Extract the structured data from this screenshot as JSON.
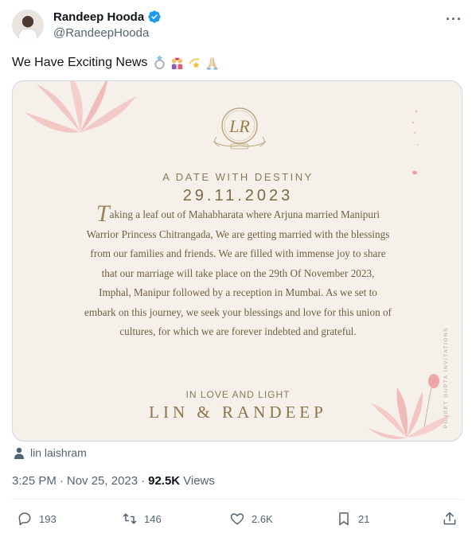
{
  "author": {
    "name": "Randeep Hooda",
    "handle": "@RandeepHooda",
    "verified": true,
    "avatar_icon": "profile-photo"
  },
  "tweet": {
    "text": "We Have Exciting News",
    "emojis": [
      "ring-emoji",
      "couple-heart-emoji",
      "dizzy-star-emoji",
      "folded-hands-emoji"
    ]
  },
  "invitation": {
    "monogram": "LR",
    "heading": "A DATE WITH DESTINY",
    "date": "29.11.2023",
    "message_dropcap": "T",
    "message": "aking a leaf out of Mahabharata where Arjuna married Manipuri Warrior Princess Chitrangada, We are getting married with the blessings from our families and friends. We are filled with immense joy to share that our marriage will take place on the 29th Of November 2023, Imphal, Manipur followed by a reception in Mumbai. As we set to embark on this journey, we seek your blessings and love for this union of cultures, for which we are forever indebted and grateful.",
    "closing": "IN LOVE AND LIGHT",
    "couple": "LIN & RANDEEP",
    "credit": "PUNEET GUPTA INVITATIONS",
    "accent_color": "#8a7a56"
  },
  "tagged_user": "lin laishram",
  "meta": {
    "time": "3:25 PM",
    "separator": "·",
    "date": "Nov 25, 2023",
    "views_count": "92.5K",
    "views_label": "Views"
  },
  "actions": {
    "replies": "193",
    "reposts": "146",
    "likes": "2.6K",
    "bookmarks": "21"
  },
  "colors": {
    "text_primary": "#0f1419",
    "text_secondary": "#536471",
    "verified_blue": "#1d9bf0",
    "card_background": "#f5f0ea"
  }
}
